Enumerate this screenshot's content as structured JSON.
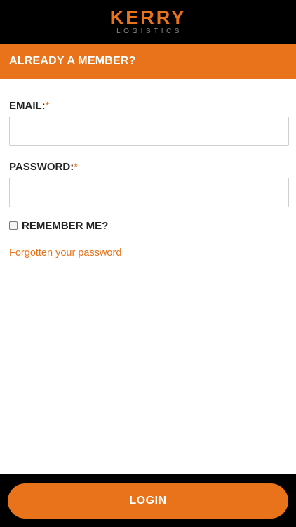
{
  "brand": {
    "logo_main": "KERRY",
    "logo_sub": "LOGISTICS"
  },
  "section": {
    "title": "ALREADY A MEMBER?"
  },
  "form": {
    "email": {
      "label": "EMAIL:",
      "required_marker": "*",
      "value": "",
      "placeholder": ""
    },
    "password": {
      "label": "PASSWORD:",
      "required_marker": "*",
      "value": "",
      "placeholder": ""
    },
    "remember": {
      "label": "REMEMBER ME?",
      "checked": false
    },
    "forgot_link": "Forgotten your password"
  },
  "footer": {
    "login_label": "LOGIN"
  },
  "colors": {
    "accent": "#e8731a",
    "header_bg": "#000000",
    "text": "#222222",
    "logo_sub": "#8a8a8a"
  }
}
